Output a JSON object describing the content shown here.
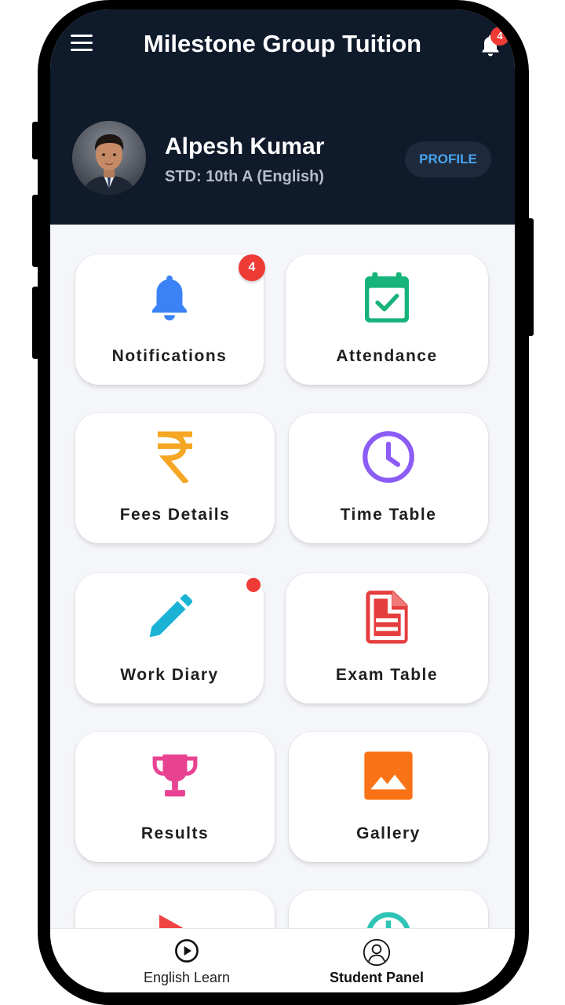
{
  "header": {
    "title": "Milestone Group Tuition",
    "notification_count": "4"
  },
  "student": {
    "name": "Alpesh Kumar",
    "std": "STD: 10th A (English)",
    "profile_button": "PROFILE"
  },
  "tiles": [
    {
      "label": "Notifications",
      "icon": "bell-icon",
      "color": "#3b82f6",
      "badge": "4"
    },
    {
      "label": "Attendance",
      "icon": "calendar-check-icon",
      "color": "#16b37a"
    },
    {
      "label": "Fees Details",
      "icon": "rupee-icon",
      "color": "#f5a623"
    },
    {
      "label": "Time Table",
      "icon": "clock-icon",
      "color": "#8b5cf6"
    },
    {
      "label": "Work Diary",
      "icon": "pencil-icon",
      "color": "#1ab3d6",
      "has_dot": true
    },
    {
      "label": "Exam Table",
      "icon": "document-icon",
      "color": "#e53e3e"
    },
    {
      "label": "Results",
      "icon": "trophy-icon",
      "color": "#e84393"
    },
    {
      "label": "Gallery",
      "icon": "image-icon",
      "color": "#f97316"
    }
  ],
  "bottom_nav": [
    {
      "label": "English Learn",
      "icon": "play-circle-icon",
      "active": false
    },
    {
      "label": "Student Panel",
      "icon": "user-circle-icon",
      "active": true
    }
  ],
  "colors": {
    "header_bg": "#0f1a2b",
    "accent": "#4aa3ee",
    "badge": "#ef3b35"
  }
}
